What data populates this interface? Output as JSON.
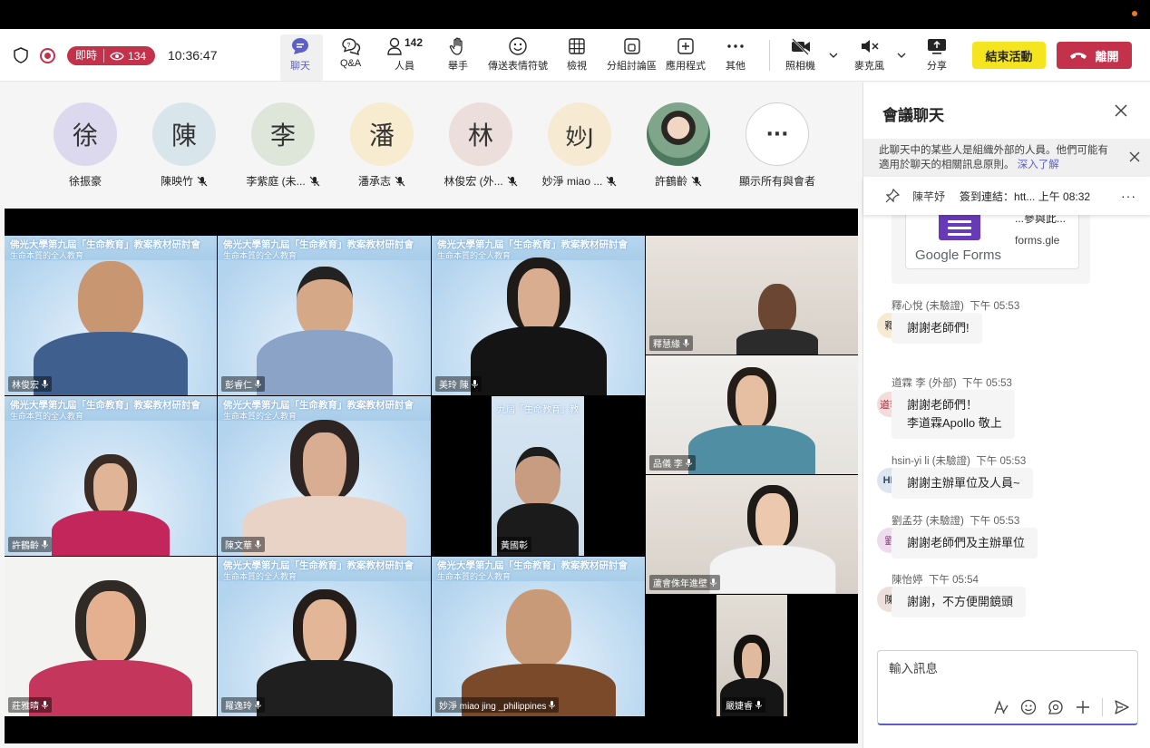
{
  "toolbar": {
    "live_label": "即時",
    "viewers": "134",
    "time": "10:36:47",
    "buttons": {
      "chat": "聊天",
      "qa": "Q&A",
      "people": "人員",
      "people_count": "142",
      "raise_hand": "舉手",
      "reactions": "傳送表情符號",
      "view": "檢視",
      "breakout": "分組討論區",
      "apps": "應用程式",
      "more": "其他",
      "camera": "照相機",
      "mic": "麥克風",
      "share": "分享"
    },
    "end_label": "結束活動",
    "leave_label": "離開"
  },
  "avatars": [
    {
      "initial": "徐",
      "name": "徐振豪",
      "color": "#dcd9ee",
      "muted": false
    },
    {
      "initial": "陳",
      "name": "陳映竹",
      "color": "#d8e5ea",
      "muted": true
    },
    {
      "initial": "李",
      "name": "李紫庭 (未...",
      "color": "#dde6d8",
      "muted": true
    },
    {
      "initial": "潘",
      "name": "潘承志",
      "color": "#f7ebd0",
      "muted": true
    },
    {
      "initial": "林",
      "name": "林俊宏 (外...",
      "color": "#ecdedb",
      "muted": true
    },
    {
      "initial": "妙J",
      "name": "妙淨 miao ...",
      "color": "#f6ead2",
      "muted": true
    },
    {
      "initial": "",
      "name": "許鶴齡",
      "color": "#6e8a74",
      "muted": true
    },
    {
      "initial": "···",
      "name": "顯示所有與會者",
      "color": "#ffffff",
      "muted": false
    }
  ],
  "slide": {
    "title": "佛光大學第九屆「生命教育」教案教材研討會",
    "subtitle": "生命本質的全人教育"
  },
  "tiles": [
    {
      "label": "林俊宏"
    },
    {
      "label": "彭睿仁"
    },
    {
      "label": "美玲 陳"
    },
    {
      "label": "釋慧緣"
    },
    {
      "label": "許鶴齡"
    },
    {
      "label": "陳文華"
    },
    {
      "label": "黃國彰"
    },
    {
      "label": "品儀 李"
    },
    {
      "label": "蘆會侏年進壁"
    },
    {
      "label": "莊雅晴"
    },
    {
      "label": "羅逸玲"
    },
    {
      "label": "妙淨 miao jing _philippines"
    },
    {
      "label": "嚴婕睿"
    }
  ],
  "chat": {
    "title": "會議聊天",
    "notice": "此聊天中的某些人是組織外部的人員。他們可能有適用於聊天的相關訊息原則。",
    "notice_link": "深入了解",
    "pinned_author": "陳芊妤",
    "pinned_text": "簽到連結：htt... 上午 08:32",
    "form_title": "...參與此...",
    "form_url": "forms.gle",
    "google_forms": "Google Forms",
    "messages": [
      {
        "author": "釋心悅 (未驗證)",
        "time": "下午 05:53",
        "initials": "釋",
        "avatar_color": "#f6ead2",
        "lines": [
          "謝謝老師們!"
        ]
      },
      {
        "author": "道霖 李 (外部)",
        "time": "下午 05:53",
        "initials": "道李",
        "avatar_color": "#f3dcdc",
        "lines": [
          "謝謝老師們！",
          "李道霖Apollo 敬上"
        ]
      },
      {
        "author": "hsin-yi li (未驗證)",
        "time": "下午 05:53",
        "initials": "HL",
        "avatar_color": "#dde6ee",
        "lines": [
          "謝謝主辦單位及人員~"
        ]
      },
      {
        "author": "劉孟芬 (未驗證)",
        "time": "下午 05:53",
        "initials": "劉",
        "avatar_color": "#ecdcec",
        "lines": [
          "謝謝老師們及主辦單位"
        ]
      },
      {
        "author": "陳怡婷",
        "time": "下午 05:54",
        "initials": "陳",
        "avatar_color": "#eddfdb",
        "lines": [
          "謝謝，不方便開鏡頭"
        ]
      }
    ],
    "compose_placeholder": "輸入訊息"
  }
}
